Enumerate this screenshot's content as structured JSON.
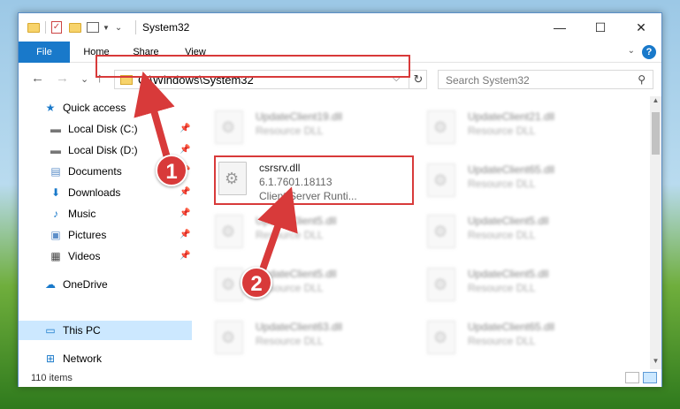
{
  "window": {
    "title": "System32",
    "minimize": "—",
    "maximize": "☐",
    "close": "✕"
  },
  "ribbon": {
    "tabs": [
      "File",
      "Home",
      "Share",
      "View"
    ],
    "help": "?"
  },
  "address": {
    "path": "C:\\Windows\\System32",
    "dropdown": "⌵",
    "refresh": "↻"
  },
  "search": {
    "placeholder": "Search System32"
  },
  "nav_buttons": {
    "back": "←",
    "forward": "→",
    "recent": "⌄",
    "up": "↑"
  },
  "sidebar": {
    "items": [
      {
        "label": "Quick access",
        "icon": "star-icon"
      },
      {
        "label": "Local Disk (C:)",
        "icon": "drive-icon",
        "pinned": true
      },
      {
        "label": "Local Disk (D:)",
        "icon": "drive-icon",
        "pinned": true
      },
      {
        "label": "Documents",
        "icon": "documents-icon",
        "pinned": true
      },
      {
        "label": "Downloads",
        "icon": "download-icon",
        "pinned": true
      },
      {
        "label": "Music",
        "icon": "music-icon",
        "pinned": true
      },
      {
        "label": "Pictures",
        "icon": "pictures-icon",
        "pinned": true
      },
      {
        "label": "Videos",
        "icon": "videos-icon",
        "pinned": true
      },
      {
        "label": "OneDrive",
        "icon": "cloud-icon"
      },
      {
        "label": "This PC",
        "icon": "computer-icon",
        "selected": true
      },
      {
        "label": "Network",
        "icon": "network-icon"
      }
    ]
  },
  "files": {
    "highlighted": {
      "name": "csrsrv.dll",
      "version": "6.1.7601.18113",
      "description": "Client Server Runti..."
    },
    "left_column": [
      {
        "name": "UpdateClient19.dll",
        "type": "Resource DLL"
      },
      {
        "name": "UpdateClient5.dll",
        "type": "Resource DLL"
      },
      {
        "name": "UpdateClient5.dll",
        "type": "Resource DLL"
      },
      {
        "name": "UpdateClient63.dll",
        "type": "Resource DLL"
      }
    ],
    "right_column": [
      {
        "name": "UpdateClient21.dll",
        "type": "Resource DLL"
      },
      {
        "name": "UpdateClient65.dll",
        "type": "Resource DLL"
      },
      {
        "name": "UpdateClient5.dll",
        "type": "Resource DLL"
      },
      {
        "name": "UpdateClient5.dll",
        "type": "Resource DLL"
      },
      {
        "name": "UpdateClient65.dll",
        "type": "Resource DLL"
      }
    ]
  },
  "status": {
    "count": "110 items"
  },
  "callouts": [
    "1",
    "2"
  ],
  "colors": {
    "accent": "#1979ca",
    "highlight": "#d83a3a",
    "selected_nav": "#cce8ff"
  }
}
